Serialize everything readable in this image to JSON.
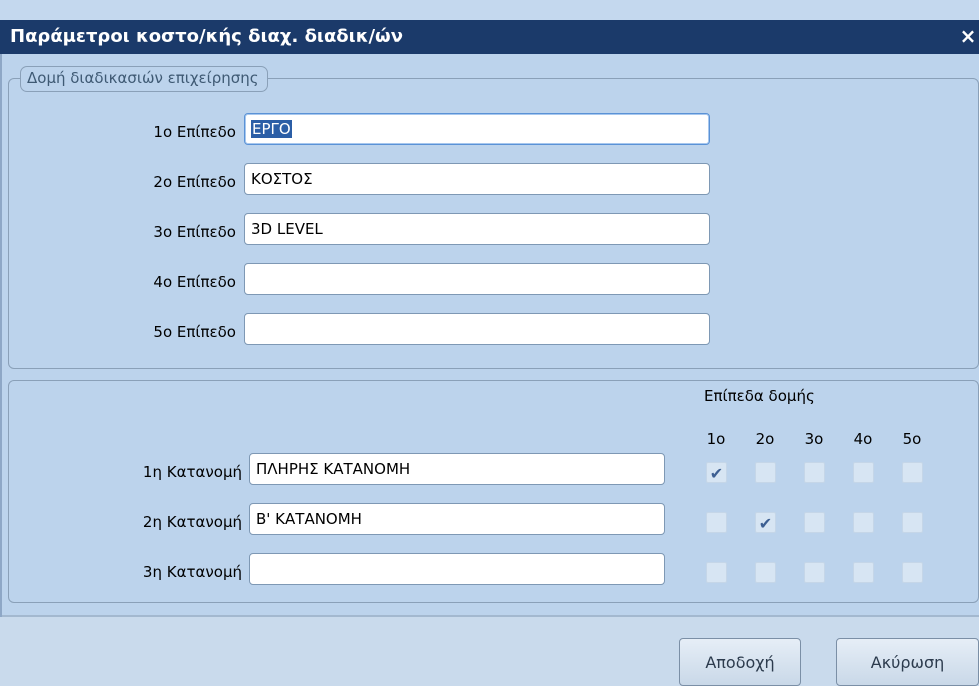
{
  "window": {
    "title": "Παράμετροι κοστο/κής διαχ. διαδικ/ών",
    "close_glyph": "×"
  },
  "structure_group": {
    "legend": "Δομή διαδικασιών επιχείρησης",
    "levels": [
      {
        "label": "1ο Επίπεδο",
        "value": "ΕΡΓΟ"
      },
      {
        "label": "2ο Επίπεδο",
        "value": "ΚΟΣΤΟΣ"
      },
      {
        "label": "3ο Επίπεδο",
        "value": "3D LEVEL"
      },
      {
        "label": "4ο Επίπεδο",
        "value": ""
      },
      {
        "label": "5ο Επίπεδο",
        "value": ""
      }
    ]
  },
  "allocation_group": {
    "header": "Επίπεδα δομής",
    "columns": [
      "1ο",
      "2ο",
      "3ο",
      "4ο",
      "5ο"
    ],
    "rows": [
      {
        "label": "1η Κατανομή",
        "value": "ΠΛΗΡΗΣ ΚΑΤΑΝΟΜΗ",
        "checks": [
          true,
          false,
          false,
          false,
          false
        ]
      },
      {
        "label": "2η Κατανομή",
        "value": "Β' ΚΑΤΑΝΟΜΗ",
        "checks": [
          false,
          true,
          false,
          false,
          false
        ]
      },
      {
        "label": "3η Κατανομή",
        "value": "",
        "checks": [
          false,
          false,
          false,
          false,
          false
        ]
      }
    ],
    "check_glyph": "✔"
  },
  "footer": {
    "accept_label": "Αποδοχή",
    "cancel_label": "Ακύρωση"
  },
  "colors": {
    "title_bar": "#1b3a6a",
    "dialog_bg": "#bcd3ec",
    "selection": "#2b5ea6"
  }
}
